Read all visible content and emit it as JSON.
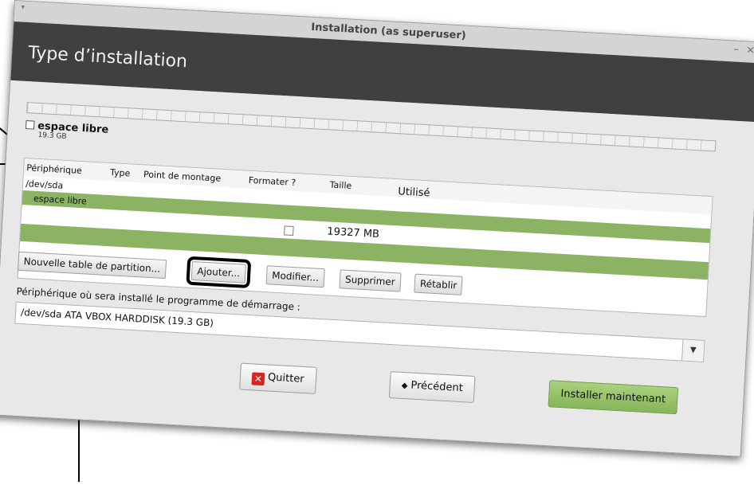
{
  "window": {
    "title": "Installation (as superuser)",
    "menu_glyph": "▾",
    "minimize_glyph": "–",
    "close_glyph": "×"
  },
  "header": {
    "title": "Type d’installation"
  },
  "partition_legend": {
    "name": "espace libre",
    "size": "19.3 GB"
  },
  "table": {
    "columns": [
      "Périphérique",
      "Type",
      "Point de montage",
      "Formater ?",
      "Taille",
      "Utilisé"
    ],
    "rows": [
      {
        "device": "/dev/sda"
      },
      {
        "device": "espace libre",
        "selected": true
      },
      {
        "size": "19327 MB",
        "format_checked": false,
        "selected": true
      }
    ]
  },
  "actions": {
    "new_table": "Nouvelle table de partition...",
    "add": "Ajouter...",
    "modify": "Modifier...",
    "delete": "Supprimer",
    "revert": "Rétablir"
  },
  "bootloader": {
    "label": "Périphérique où sera installé le programme de démarrage :",
    "value": "/dev/sda  ATA VBOX HARDDISK (19.3 GB)"
  },
  "footer": {
    "quit": "Quitter",
    "back": "Précédent",
    "back_icon": "◆",
    "install": "Installer maintenant",
    "quit_icon_glyph": "✕"
  },
  "colors": {
    "header_bg": "#404040",
    "selection_green": "#8bb363",
    "install_button": "#86b55a",
    "highlight_outline": "#000000"
  },
  "icons": {
    "quit": "close-red-icon",
    "back": "arrow-left-icon",
    "dropdown": "chevron-down-icon"
  }
}
